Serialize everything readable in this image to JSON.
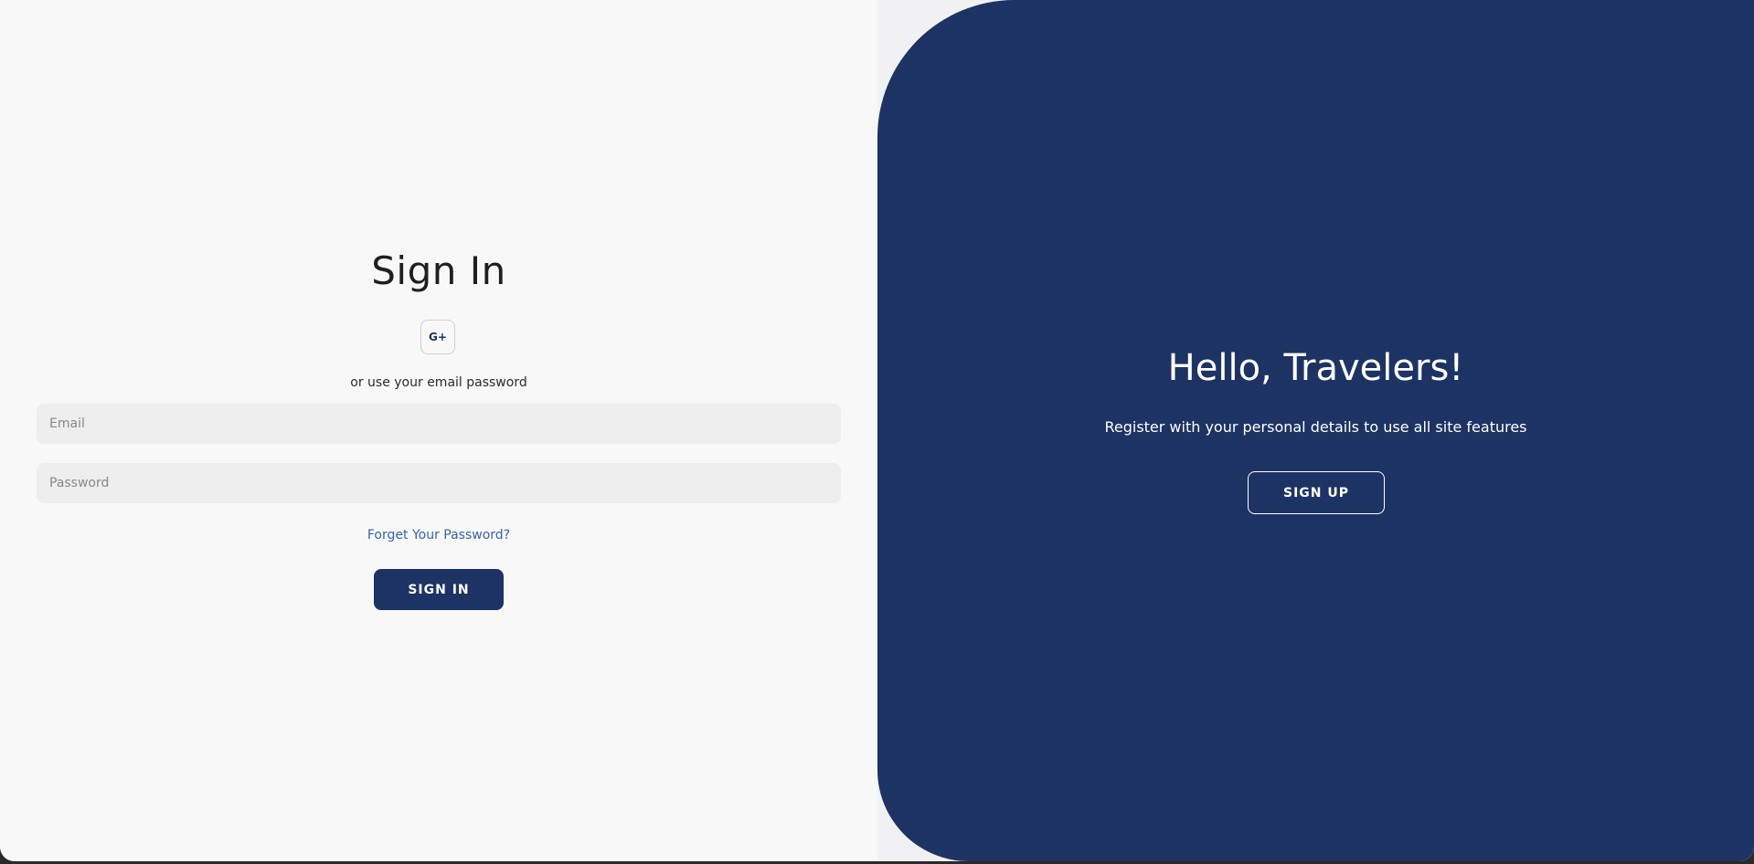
{
  "signin": {
    "title": "Sign In",
    "social_label": "G+",
    "social_icon": "google-plus-icon",
    "alt_text": "or use your email password",
    "email_placeholder": "Email",
    "password_placeholder": "Password",
    "forgot_label": "Forget Your Password?",
    "button_label": "SIGN IN"
  },
  "signup_panel": {
    "title": "Hello, Travelers!",
    "subtitle": "Register with your personal details to use all site features",
    "button_label": "SIGN UP"
  },
  "colors": {
    "primary": "#1d3363",
    "link": "#3a62a8",
    "input_bg": "#eeeeee",
    "page_bg": "#f8f8f9"
  }
}
